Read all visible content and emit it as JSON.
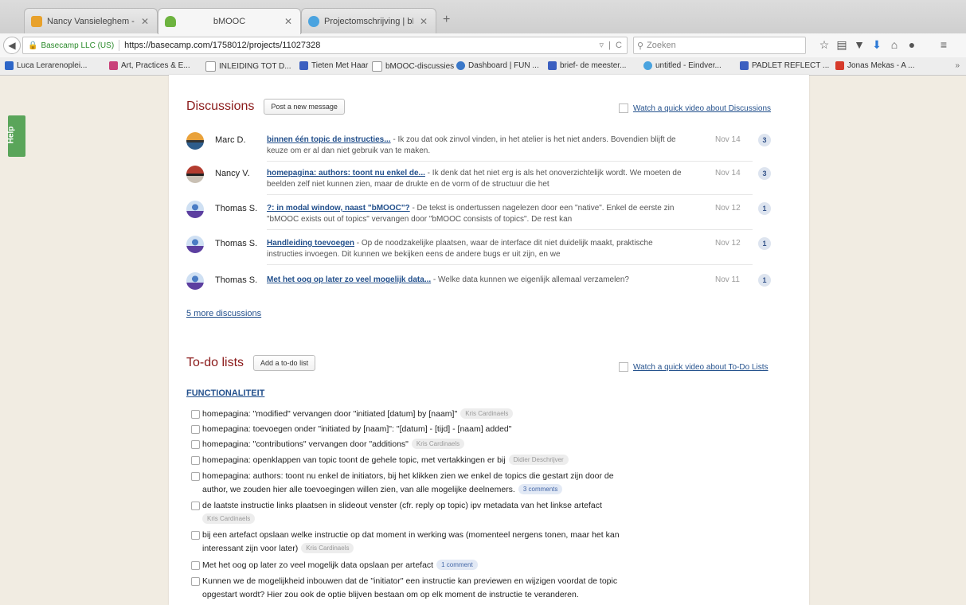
{
  "browser": {
    "tabs": [
      {
        "title": "Nancy Vansieleghem - Ou...",
        "active": false,
        "icon": "mail-icon",
        "icon_color": "#e8a12b"
      },
      {
        "title": "bMOOC",
        "active": true,
        "icon": "basecamp-icon",
        "icon_color": "#6db33f"
      },
      {
        "title": "Projectomschrijving | bMo...",
        "active": false,
        "icon": "globe-icon",
        "icon_color": "#4aa3df"
      }
    ],
    "new_tab": "+",
    "site_identity": "Basecamp LLC (US)",
    "url": "https://basecamp.com/1758012/projects/11027328",
    "search_placeholder": "Zoeken",
    "bookmarks": [
      "Luca Lerarenoplei...",
      "Art, Practices & E...",
      "INLEIDING TOT D...",
      "Tieten Met Haar",
      "bMOOC-discussies",
      "Dashboard | FUN ...",
      "brief- de meester...",
      "untitled - Eindver...",
      "PADLET REFLECT ...",
      "Jonas Mekas - A ..."
    ],
    "bookmarks_more": "»"
  },
  "help": {
    "label": "Help"
  },
  "discussions": {
    "title": "Discussions",
    "post_button": "Post a new message",
    "video_link": "Watch a quick video about Discussions",
    "items": [
      {
        "author": "Marc D.",
        "subject": "binnen één topic de instructies...",
        "excerpt": " - Ik zou dat ook zinvol vinden, in het atelier is het niet anders. Bovendien blijft de keuze om er al dan niet gebruik van te maken.",
        "date": "Nov 14",
        "count": "3"
      },
      {
        "author": "Nancy V.",
        "subject": "homepagina: authors: toont nu enkel de...",
        "excerpt": " - Ik denk dat het niet erg is als het onoverzichtelijk wordt. We moeten de beelden zelf niet kunnen zien, maar de drukte en de vorm of de structuur die het",
        "date": "Nov 14",
        "count": "3"
      },
      {
        "author": "Thomas S.",
        "subject": "?: in modal window, naast \"bMOOC\"?",
        "excerpt": " - De tekst is ondertussen nagelezen door een \"native\". Enkel de eerste zin \"bMOOC exists out of topics\" vervangen door \"bMOOC consists of topics\". De rest kan",
        "date": "Nov 12",
        "count": "1"
      },
      {
        "author": "Thomas S.",
        "subject": "Handleiding toevoegen",
        "excerpt": " - Op de noodzakelijke plaatsen, waar de interface dit niet duidelijk maakt, praktische instructies invoegen. Dit kunnen we bekijken eens de andere bugs er uit zijn, en we",
        "date": "Nov 12",
        "count": "1"
      },
      {
        "author": "Thomas S.",
        "subject": "Met het oog op later zo veel mogelijk data...",
        "excerpt": " - Welke data kunnen we eigenlijk allemaal verzamelen?",
        "date": "Nov 11",
        "count": "1"
      }
    ],
    "more_link": "5 more discussions"
  },
  "todos": {
    "title": "To-do lists",
    "add_button": "Add a to-do list",
    "video_link": "Watch a quick video about To-Do Lists",
    "list_title": "FUNCTIONALITEIT",
    "items": [
      {
        "lines": [
          "homepagina: \"modified\" vervangen door \"initiated [datum] by [naam]\""
        ],
        "badge": "Kris Cardinaels",
        "badge_type": "assignee"
      },
      {
        "lines": [
          "homepagina: toevoegen onder \"initiated by [naam]\": \"[datum] - [tijd] - [naam] added\""
        ],
        "badge": "",
        "badge_type": ""
      },
      {
        "lines": [
          "homepagina: \"contributions\" vervangen door \"additions\""
        ],
        "badge": "Kris Cardinaels",
        "badge_type": "assignee"
      },
      {
        "lines": [
          "homepagina: openklappen van topic toont de gehele topic, met vertakkingen er bij"
        ],
        "badge": "Didier Deschrijver",
        "badge_type": "assignee"
      },
      {
        "lines": [
          "homepagina: authors: toont nu enkel de initiators, bij het klikken zien we enkel de topics die gestart zijn door de",
          "author, we zouden hier alle toevoegingen willen zien, van alle mogelijke deelnemers."
        ],
        "badge": "3 comments",
        "badge_type": "comments"
      },
      {
        "lines": [
          "de laatste instructie links plaatsen in slideout venster (cfr. reply op topic) ipv metadata van het linkse artefact"
        ],
        "badge": "Kris Cardinaels",
        "badge_type": "assignee",
        "badge_newline": true
      },
      {
        "lines": [
          "bij een artefact opslaan welke instructie op dat moment in werking was (momenteel nergens tonen, maar het kan",
          "interessant zijn voor later)"
        ],
        "badge": "Kris Cardinaels",
        "badge_type": "assignee"
      },
      {
        "lines": [
          "Met het oog op later zo veel mogelijk data opslaan per artefact"
        ],
        "badge": "1 comment",
        "badge_type": "comments"
      },
      {
        "lines": [
          "Kunnen we de mogelijkheid inbouwen dat de \"initiator\" een instructie kan previewen en wijzigen voordat de topic",
          "opgestart wordt? Hier zou ook de optie blijven bestaan om op elk moment de instructie te veranderen."
        ],
        "badge": "",
        "badge_type": ""
      }
    ]
  },
  "colors": {
    "section_title": "#8b1a1a",
    "link": "#23508c",
    "page_bg": "#f1ece2",
    "help_tab": "#5aa55a"
  }
}
